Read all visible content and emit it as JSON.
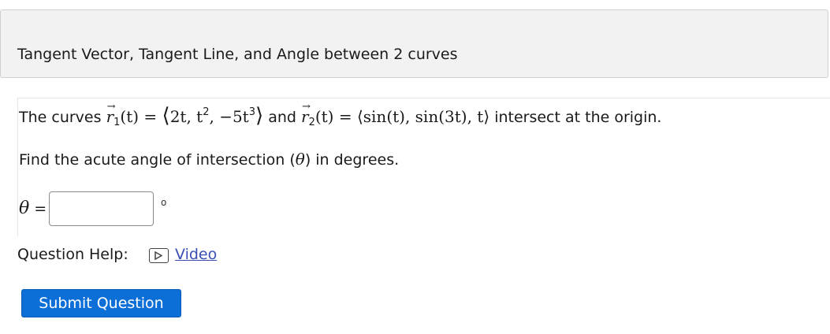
{
  "header": {
    "title": "Tangent Vector, Tangent Line, and Angle between 2 curves"
  },
  "question": {
    "intro": "The curves",
    "r1": "r",
    "r1_sub": "1",
    "r1_arg": "(t) = ",
    "r1_open": "⟨",
    "r1_comp1": "2t, t",
    "r1_sup1": "2",
    "r1_comp2": ", −5t",
    "r1_sup2": "3",
    "r1_close": "⟩",
    "and": "and",
    "r2": "r",
    "r2_sub": "2",
    "r2_arg": "(t) = ",
    "r2_expr": "⟨sin(t), sin(3t), t⟩",
    "outro": "intersect at the origin.",
    "prompt_before": "Find the acute angle of intersection (",
    "prompt_symbol": "θ",
    "prompt_after": ") in degrees."
  },
  "answer": {
    "symbol": "θ",
    "equals": " =",
    "value": "",
    "placeholder": "",
    "unit": "o"
  },
  "help": {
    "label": "Question Help:",
    "icon": "play-video-icon",
    "video_label": "Video"
  },
  "actions": {
    "submit_label": "Submit Question"
  },
  "colors": {
    "submit_bg": "#0c6fd8",
    "link": "#3a4fb5",
    "header_bg": "#f2f2f2"
  }
}
